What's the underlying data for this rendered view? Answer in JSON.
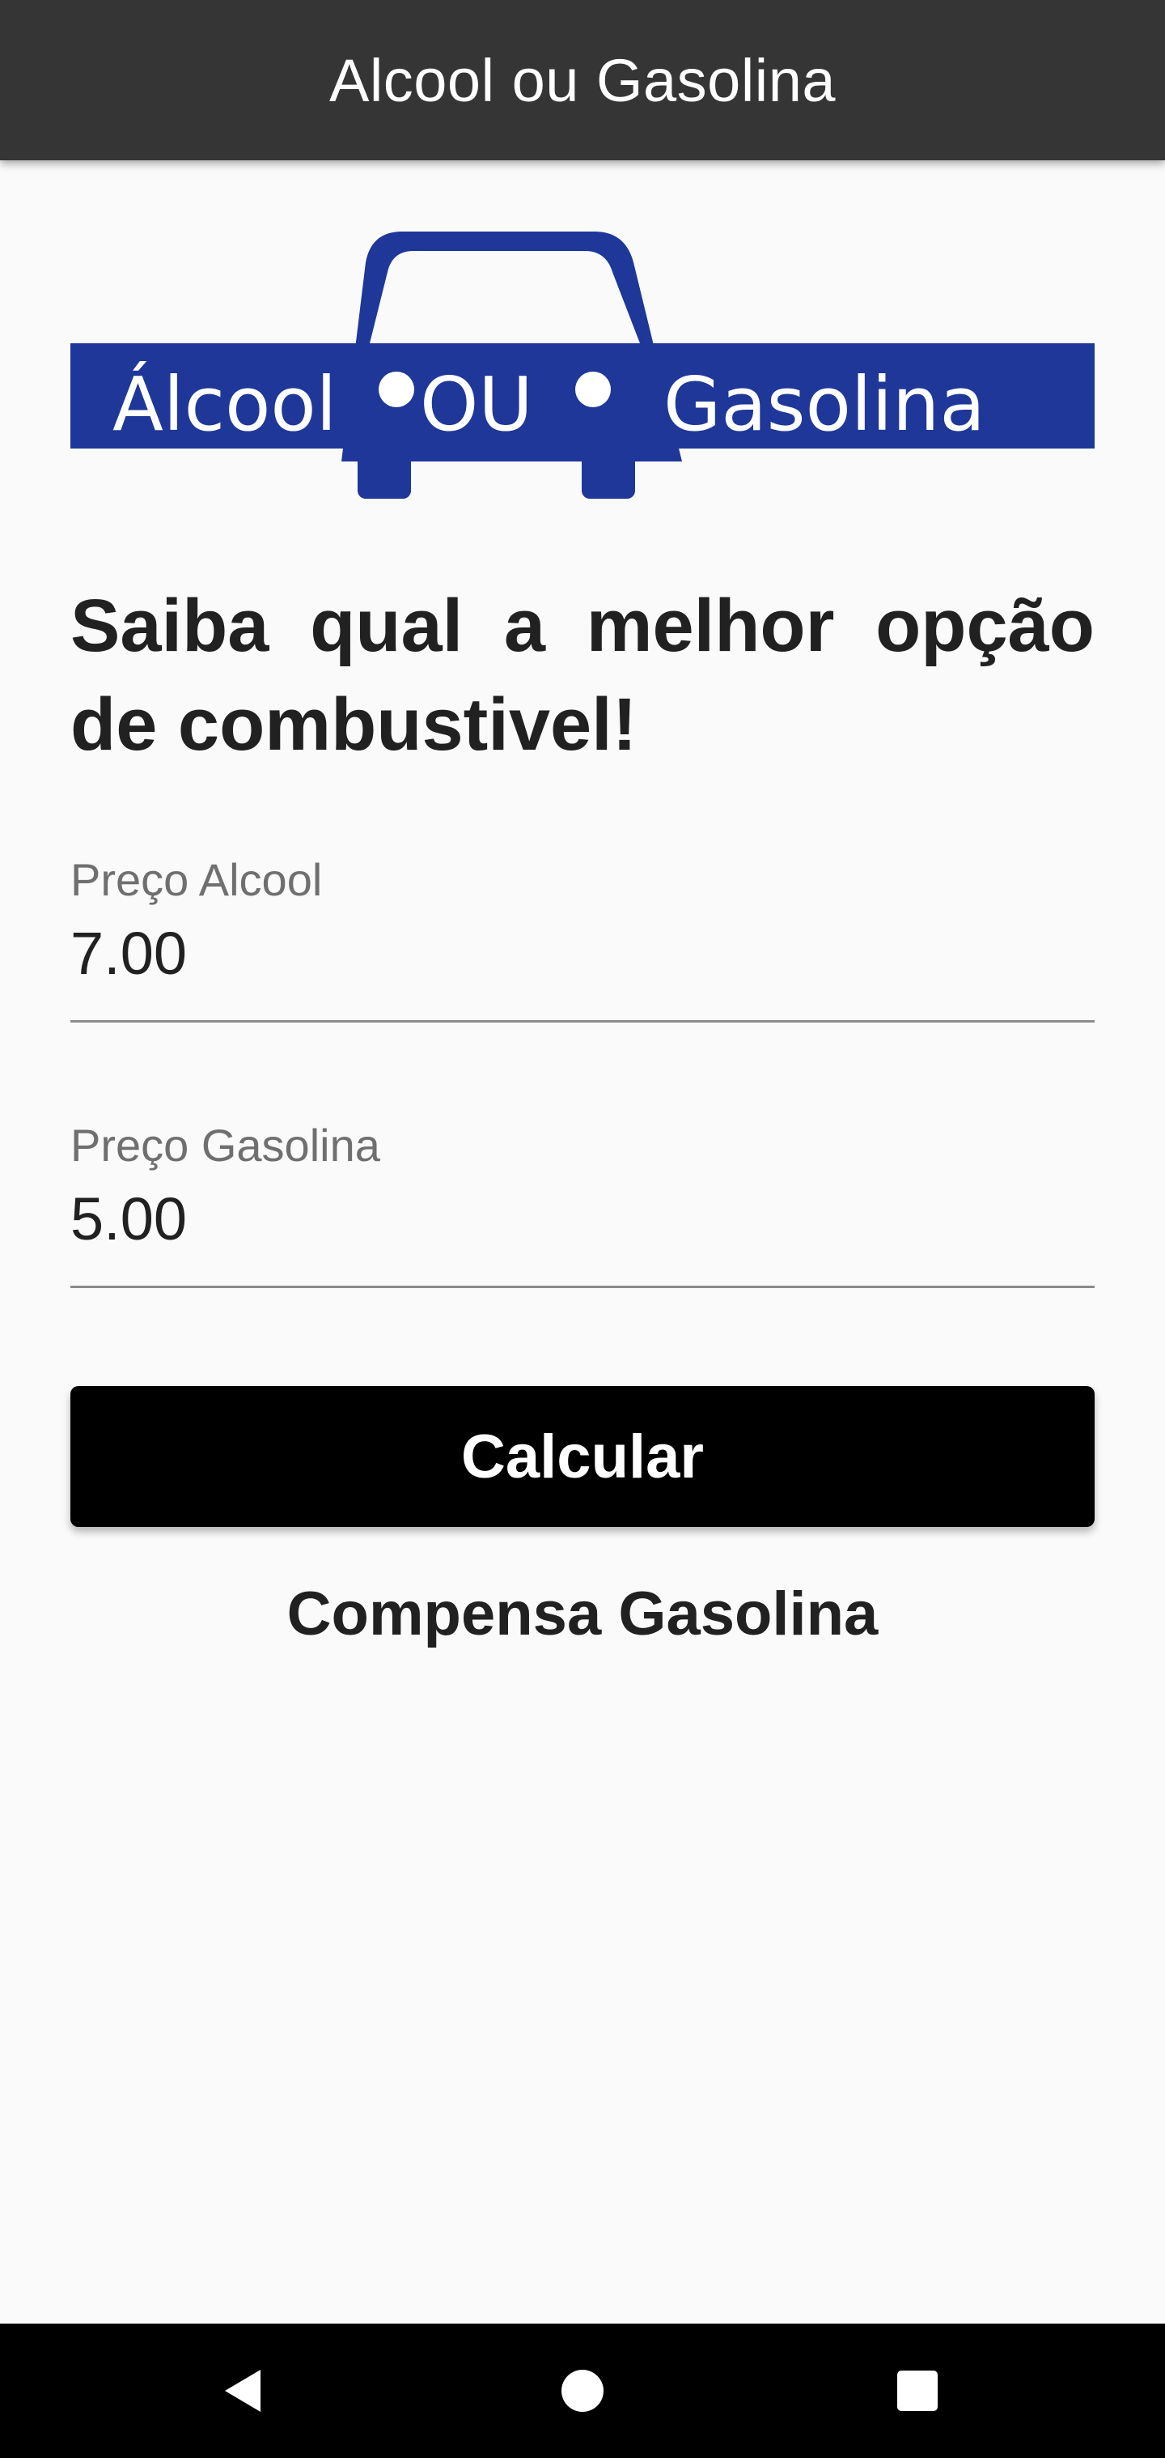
{
  "app_bar": {
    "title": "Alcool ou Gasolina"
  },
  "logo": {
    "text_left": "Álcool",
    "text_middle": "OU",
    "text_right": "Gasolina",
    "color": "#1e3799"
  },
  "headline": "Saiba qual a melhor opção de combustivel!",
  "fields": {
    "alcool": {
      "label": "Preço Alcool",
      "value": "7.00"
    },
    "gasolina": {
      "label": "Preço Gasolina",
      "value": "5.00"
    }
  },
  "calculate_button": {
    "label": "Calcular"
  },
  "result": "Compensa Gasolina",
  "nav_bar": {
    "back_icon": "triangle-back-icon",
    "home_icon": "circle-home-icon",
    "recents_icon": "square-recents-icon"
  }
}
